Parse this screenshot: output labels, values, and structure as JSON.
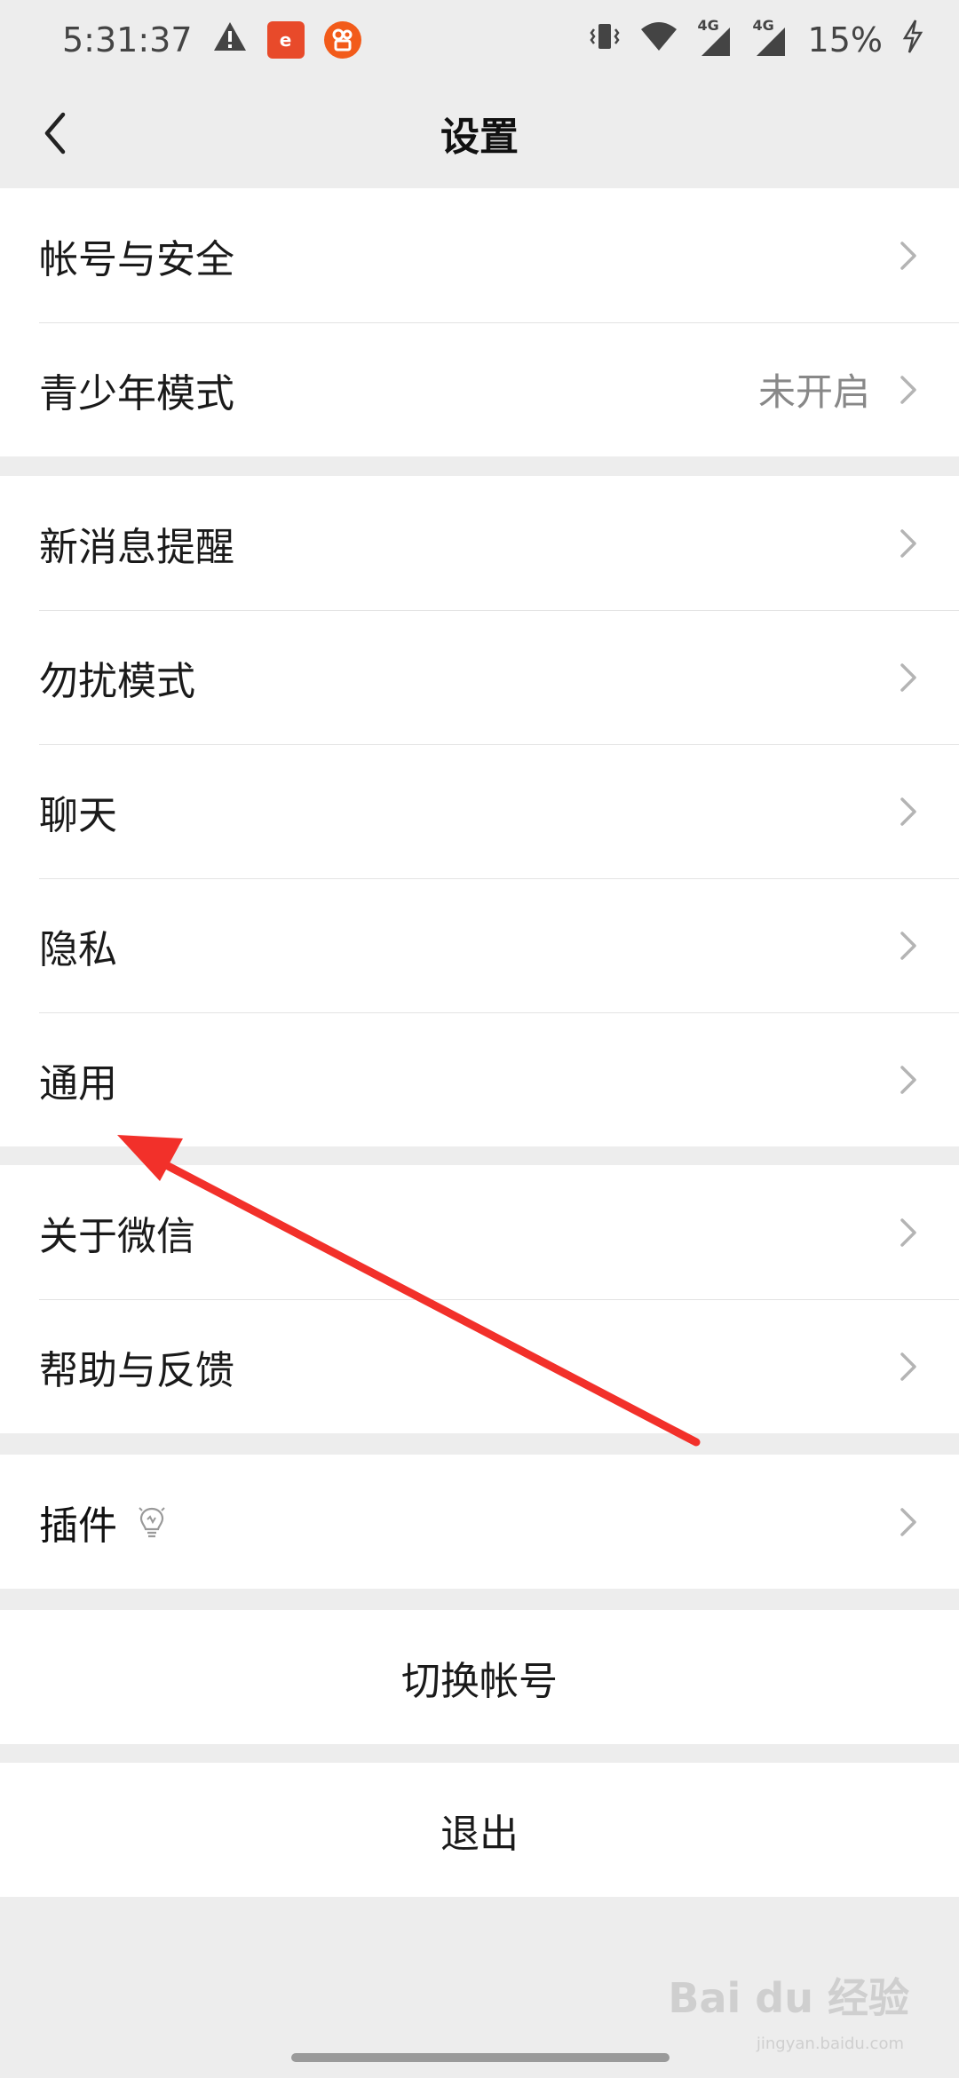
{
  "status": {
    "time": "5:31:37",
    "battery": "15%",
    "net1": "4G",
    "net2": "4G"
  },
  "header": {
    "title": "设置"
  },
  "groups": [
    {
      "items": [
        {
          "label": "帐号与安全"
        },
        {
          "label": "青少年模式",
          "value": "未开启"
        }
      ]
    },
    {
      "items": [
        {
          "label": "新消息提醒"
        },
        {
          "label": "勿扰模式"
        },
        {
          "label": "聊天"
        },
        {
          "label": "隐私"
        },
        {
          "label": "通用"
        }
      ]
    },
    {
      "items": [
        {
          "label": "关于微信"
        },
        {
          "label": "帮助与反馈"
        }
      ]
    },
    {
      "items": [
        {
          "label": "插件"
        }
      ]
    }
  ],
  "actions": {
    "switch_account": "切换帐号",
    "logout": "退出"
  },
  "watermark": {
    "brand": "Bai du 经验",
    "url": "jingyan.baidu.com"
  },
  "colors": {
    "annotation_arrow": "#f2302a",
    "background": "#ededed"
  }
}
